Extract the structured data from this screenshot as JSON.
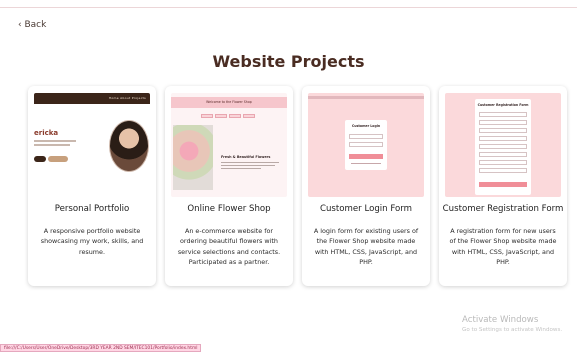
{
  "header": {
    "back_label": "‹ Back"
  },
  "page": {
    "title": "Website Projects"
  },
  "projects": [
    {
      "title": "Personal Portfolio",
      "description": "A responsive portfolio website showcasing my work, skills, and resume.",
      "preview": {
        "name": "ericka",
        "nav_text": "Home  About  Projects"
      }
    },
    {
      "title": "Online Flower Shop",
      "description": "An e-commerce website for ordering beautiful flowers with service selections and contacts. Participated as a partner.",
      "preview": {
        "header_text": "Welcome to the Flower Shop",
        "heading": "Fresh & Beautiful Flowers"
      }
    },
    {
      "title": "Customer Login Form",
      "description": "A login form for existing users of the Flower Shop website made with HTML, CSS, JavaScript, and PHP.",
      "preview": {
        "heading": "Customer Login"
      }
    },
    {
      "title": "Customer Registration Form",
      "description": "A registration form for new users of the Flower Shop website made with HTML, CSS, JavaScript, and PHP.",
      "preview": {
        "heading": "Customer Registration Form"
      }
    }
  ],
  "os": {
    "activate_title": "Activate Windows",
    "activate_sub": "Go to Settings to activate Windows."
  },
  "status": {
    "url": "file:///C:/Users/User/OneDrive/Desktop/3RD YEAR 2ND SEM/ITEC101/Portfolio/index.html"
  },
  "colors": {
    "accent_dark": "#3b2519",
    "accent_pink": "#f08e98",
    "title": "#4a2c22"
  }
}
